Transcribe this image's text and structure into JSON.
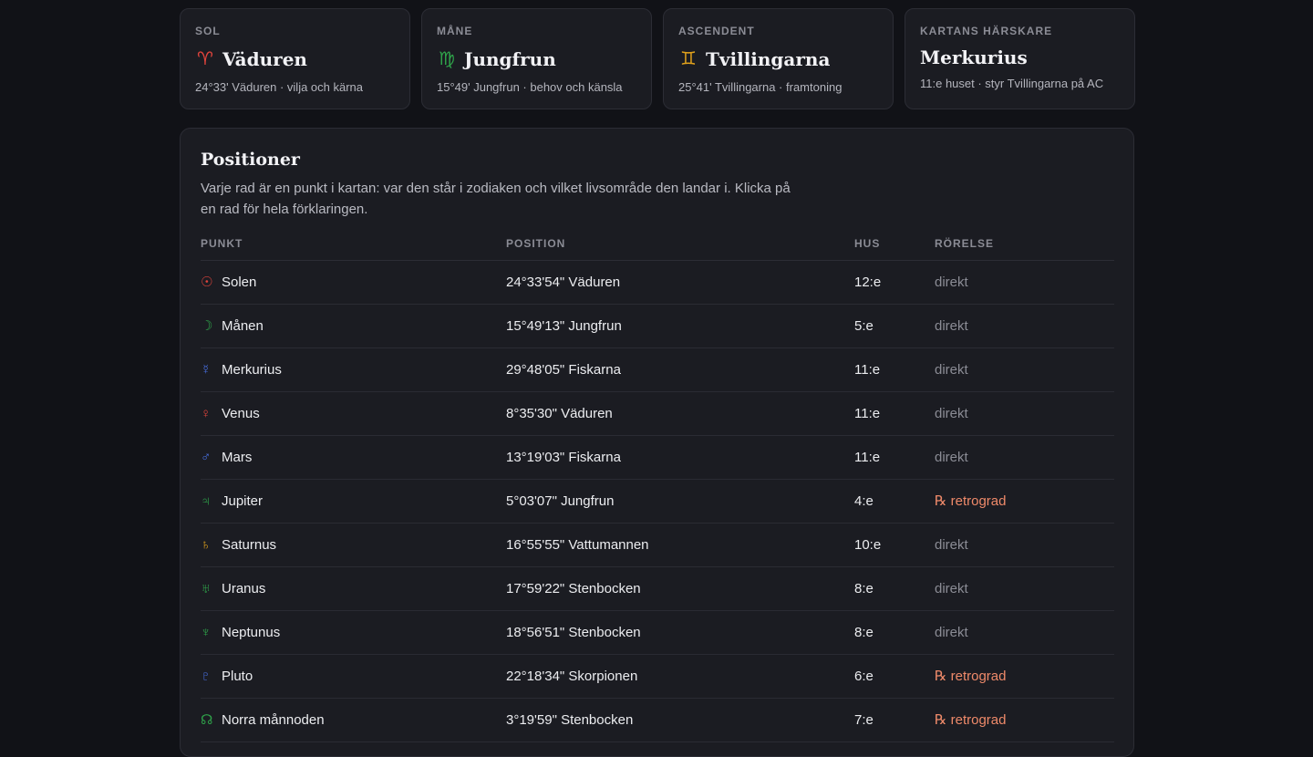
{
  "cards": [
    {
      "kicker": "SOL",
      "symbol": "♈",
      "symbol_color": "#e0443c",
      "name": "Väduren",
      "sub": "24°33' Väduren · vilja och kärna"
    },
    {
      "kicker": "MÅNE",
      "symbol": "♍",
      "symbol_color": "#2fa34a",
      "name": "Jungfrun",
      "sub": "15°49' Jungfrun · behov och känsla"
    },
    {
      "kicker": "ASCENDENT",
      "symbol": "♊",
      "symbol_color": "#e0a11c",
      "name": "Tvillingarna",
      "sub": "25°41' Tvillingarna · framtoning"
    },
    {
      "kicker": "KARTANS HÄRSKARE",
      "name": "Merkurius",
      "sub": "11:e huset · styr Tvillingarna på AC"
    }
  ],
  "panel": {
    "title": "Positioner",
    "description": "Varje rad är en punkt i kartan: var den står i zodiaken och vilket livsområde den landar i. Klicka på en rad för hela förklaringen.",
    "columns": [
      "PUNKT",
      "POSITION",
      "HUS",
      "RÖRELSE"
    ],
    "rows": [
      {
        "glyph": "☉",
        "glyph_color": "#e0443c",
        "name": "Solen",
        "position": "24°33'54\" Väduren",
        "house": "12:e",
        "motion": "direkt",
        "retro": false
      },
      {
        "glyph": "☽",
        "glyph_color": "#2fa34a",
        "name": "Månen",
        "position": "15°49'13\" Jungfrun",
        "house": "5:e",
        "motion": "direkt",
        "retro": false
      },
      {
        "glyph": "☿",
        "glyph_color": "#4a72e8",
        "name": "Merkurius",
        "position": "29°48'05\" Fiskarna",
        "house": "11:e",
        "motion": "direkt",
        "retro": false
      },
      {
        "glyph": "♀",
        "glyph_color": "#e0443c",
        "name": "Venus",
        "position": "8°35'30\" Väduren",
        "house": "11:e",
        "motion": "direkt",
        "retro": false
      },
      {
        "glyph": "♂",
        "glyph_color": "#4a72e8",
        "name": "Mars",
        "position": "13°19'03\" Fiskarna",
        "house": "11:e",
        "motion": "direkt",
        "retro": false
      },
      {
        "glyph": "♃",
        "glyph_color": "#2fa34a",
        "name": "Jupiter",
        "position": "5°03'07\" Jungfrun",
        "house": "4:e",
        "motion": "℞ retrograd",
        "retro": true
      },
      {
        "glyph": "♄",
        "glyph_color": "#e0a11c",
        "name": "Saturnus",
        "position": "16°55'55\" Vattumannen",
        "house": "10:e",
        "motion": "direkt",
        "retro": false
      },
      {
        "glyph": "♅",
        "glyph_color": "#2fa34a",
        "name": "Uranus",
        "position": "17°59'22\" Stenbocken",
        "house": "8:e",
        "motion": "direkt",
        "retro": false
      },
      {
        "glyph": "♆",
        "glyph_color": "#2fa34a",
        "name": "Neptunus",
        "position": "18°56'51\" Stenbocken",
        "house": "8:e",
        "motion": "direkt",
        "retro": false
      },
      {
        "glyph": "♇",
        "glyph_color": "#4a72e8",
        "name": "Pluto",
        "position": "22°18'34\" Skorpionen",
        "house": "6:e",
        "motion": "℞ retrograd",
        "retro": true
      },
      {
        "glyph": "☊",
        "glyph_color": "#2fa34a",
        "name": "Norra månnoden",
        "position": "3°19'59\" Stenbocken",
        "house": "7:e",
        "motion": "℞ retrograd",
        "retro": true
      }
    ]
  }
}
